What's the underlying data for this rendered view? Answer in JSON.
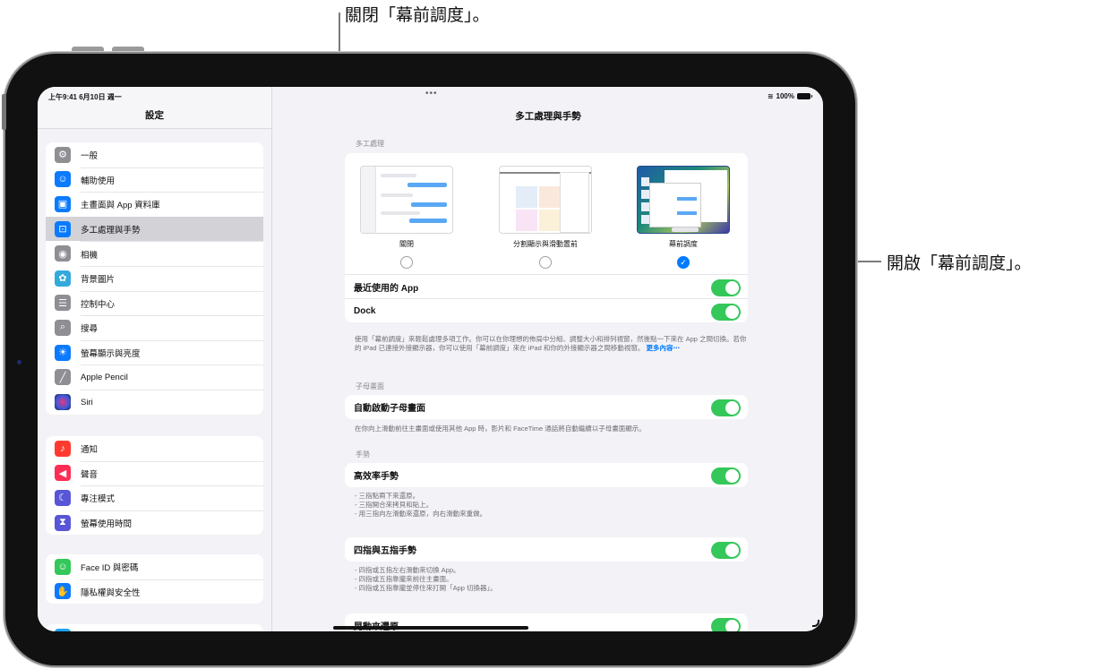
{
  "callouts": {
    "off": "關閉「幕前調度」。",
    "on": "開啟「幕前調度」。"
  },
  "status_bar": {
    "time_date": "上午9:41  6月10日 週一",
    "wifi_icon": "wifi-icon",
    "battery": "100%",
    "battery_icon": "battery-full-icon",
    "multitask_dots": "•••"
  },
  "sidebar": {
    "title": "設定",
    "groups": [
      {
        "items": [
          {
            "label": "一般",
            "icon": "gear-icon",
            "color": "#8e8e93",
            "glyph": "⚙"
          },
          {
            "label": "輔助使用",
            "icon": "accessibility-icon",
            "color": "#0a7aff",
            "glyph": "♿"
          },
          {
            "label": "主畫面與 App 資料庫",
            "icon": "home-screen-icon",
            "color": "#0a7aff",
            "glyph": "▣"
          },
          {
            "label": "多工處理與手勢",
            "icon": "multitasking-icon",
            "color": "#0a7aff",
            "glyph": "⊡",
            "selected": true
          },
          {
            "label": "相機",
            "icon": "camera-icon",
            "color": "#8e8e93",
            "glyph": "◉"
          },
          {
            "label": "背景圖片",
            "icon": "wallpaper-icon",
            "color": "#34aadc",
            "glyph": "✿"
          },
          {
            "label": "控制中心",
            "icon": "control-center-icon",
            "color": "#8e8e93",
            "glyph": "☰"
          },
          {
            "label": "搜尋",
            "icon": "search-icon",
            "color": "#8e8e93",
            "glyph": "⌕"
          },
          {
            "label": "螢幕顯示與亮度",
            "icon": "brightness-icon",
            "color": "#0a7aff",
            "glyph": "☀"
          },
          {
            "label": "Apple Pencil",
            "icon": "pencil-icon",
            "color": "#8e8e93",
            "glyph": "╱"
          },
          {
            "label": "Siri",
            "icon": "siri-icon",
            "color": "#2a2a3a",
            "glyph": "●"
          }
        ]
      },
      {
        "items": [
          {
            "label": "通知",
            "icon": "notifications-icon",
            "color": "#ff3b30",
            "glyph": "🔔"
          },
          {
            "label": "聲音",
            "icon": "sound-icon",
            "color": "#ff2d55",
            "glyph": "🔊"
          },
          {
            "label": "專注模式",
            "icon": "focus-moon-icon",
            "color": "#5856d6",
            "glyph": "☾"
          },
          {
            "label": "螢幕使用時間",
            "icon": "hourglass-icon",
            "color": "#5856d6",
            "glyph": "⧗"
          }
        ]
      },
      {
        "items": [
          {
            "label": "Face ID 與密碼",
            "icon": "face-id-icon",
            "color": "#34c759",
            "glyph": "☺"
          },
          {
            "label": "隱私權與安全性",
            "icon": "privacy-hand-icon",
            "color": "#0a7aff",
            "glyph": "✋"
          }
        ]
      },
      {
        "items": [
          {
            "label": "",
            "icon": "app-store-icon",
            "color": "#1ea1f2",
            "glyph": ""
          }
        ]
      }
    ]
  },
  "detail": {
    "title": "多工處理與手勢",
    "multitasking": {
      "header": "多工處理",
      "options": [
        {
          "label": "關閉",
          "selected": false
        },
        {
          "label": "分割顯示與滑動置前",
          "selected": false
        },
        {
          "label": "幕前調度",
          "selected": true
        }
      ],
      "toggles": [
        {
          "label": "最近使用的 App",
          "on": true
        },
        {
          "label": "Dock",
          "on": true
        }
      ],
      "footer": "使用「幕前調度」來輕鬆處理多項工作。你可以在你理想的佈局中分組、調整大小和排列視窗，然後點一下來在 App 之間切換。若你的 iPad 已連接外接顯示器，你可以使用「幕前調度」來在 iPad 和你的外接顯示器之間移動視窗。",
      "more_link": "更多內容⋯"
    },
    "pip": {
      "header": "子母畫面",
      "toggle": {
        "label": "自動啟動子母畫面",
        "on": true
      },
      "footer": "在你向上滑動前往主畫面或使用其他 App 時，影片和 FaceTime 通話將自動繼續以子母畫面顯示。"
    },
    "gestures": {
      "header": "手勢",
      "efficient": {
        "label": "高效率手勢",
        "on": true
      },
      "efficient_notes": [
        "- 三指點兩下來還原。",
        "- 三指開合來拷貝和貼上。",
        "- 用三指向左滑動來還原，向右滑動來重做。"
      ],
      "four_five": {
        "label": "四指與五指手勢",
        "on": true
      },
      "four_five_notes": [
        "- 四指或五指左右滑動來切換 App。",
        "- 四指或五指靠攏來前往主畫面。",
        "- 四指或五指靠攏並停住來打開「App 切換器」。"
      ],
      "shake": {
        "label": "晃動來還原",
        "on": true
      }
    }
  },
  "colors": {
    "accent": "#007aff",
    "toggle_on": "#34c759",
    "background": "#f2f2f7"
  }
}
